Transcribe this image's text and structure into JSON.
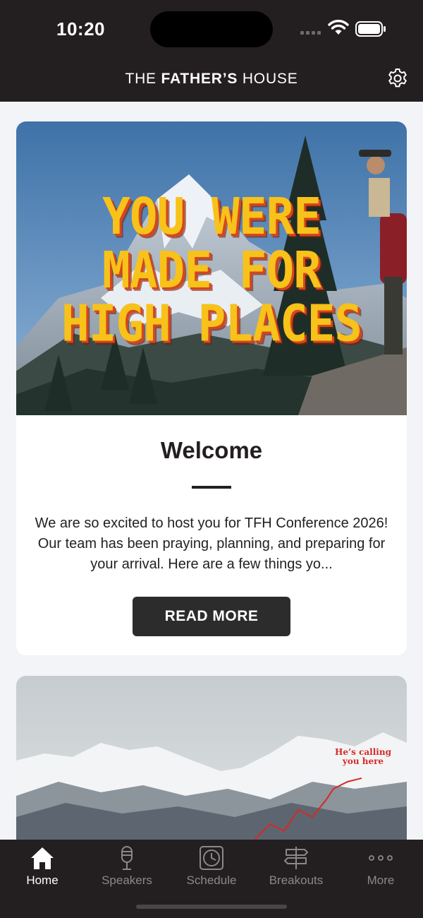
{
  "status_bar": {
    "time": "10:20"
  },
  "header": {
    "title_prefix": "THE ",
    "title_bold": "FATHER’S",
    "title_suffix": " HOUSE"
  },
  "cards": [
    {
      "hero_text": [
        "YOU WERE",
        "MADE FOR",
        "HIGH PLACES"
      ],
      "title": "Welcome",
      "body": "We are so excited to host you for TFH Conference 2026! Our team has been praying, planning, and preparing for your arrival. Here are a few things yo...",
      "button_label": "READ MORE"
    },
    {
      "image_caption": [
        "He’s calling",
        "you here"
      ]
    }
  ],
  "tabbar": {
    "tabs": [
      {
        "label": "Home",
        "icon": "house-icon",
        "active": true
      },
      {
        "label": "Speakers",
        "icon": "microphone-icon",
        "active": false
      },
      {
        "label": "Schedule",
        "icon": "clock-icon",
        "active": false
      },
      {
        "label": "Breakouts",
        "icon": "signpost-icon",
        "active": false
      },
      {
        "label": "More",
        "icon": "ellipsis-icon",
        "active": false
      }
    ]
  },
  "colors": {
    "header_bg": "#231f20",
    "page_bg": "#f3f4f8",
    "hero_text": "#f7c21a",
    "hero_text_shadow": "#d8451c",
    "button_bg": "#2c2c2c",
    "tab_inactive": "#8c8889",
    "tab_active": "#ffffff"
  }
}
